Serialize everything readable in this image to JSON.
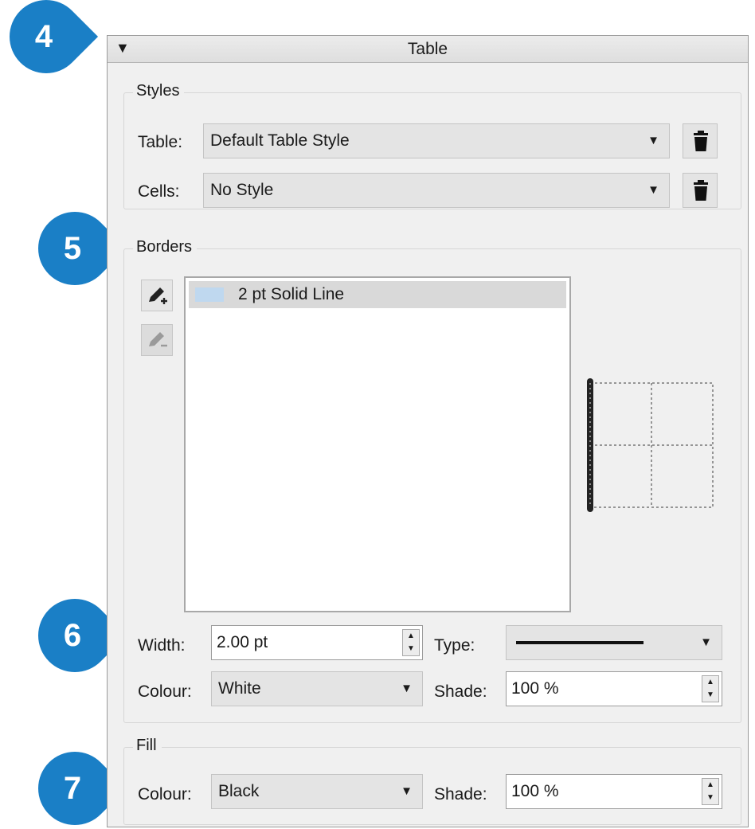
{
  "callouts": [
    "4",
    "5",
    "6",
    "7"
  ],
  "panel": {
    "title": "Table",
    "collapse_icon": "triangle-down-icon",
    "styles": {
      "label": "Styles",
      "table_label": "Table:",
      "table_value": "Default Table Style",
      "cells_label": "Cells:",
      "cells_value": "No Style",
      "delete_icon": "trash-icon"
    },
    "borders": {
      "label": "Borders",
      "add_icon": "pen-add-icon",
      "edit_icon": "pen-edit-icon",
      "list_items": [
        "2 pt Solid Line"
      ],
      "width_label": "Width:",
      "width_value": "2.00 pt",
      "type_label": "Type:",
      "colour_label": "Colour:",
      "colour_value": "White",
      "shade_label": "Shade:",
      "shade_value": "100 %"
    },
    "fill": {
      "label": "Fill",
      "colour_label": "Colour:",
      "colour_value": "Black",
      "shade_label": "Shade:",
      "shade_value": "100 %"
    }
  },
  "colors": {
    "callout": "#1a7fc6",
    "list_selection": "#d9d9d9",
    "swatch": "#bfd8ef"
  }
}
